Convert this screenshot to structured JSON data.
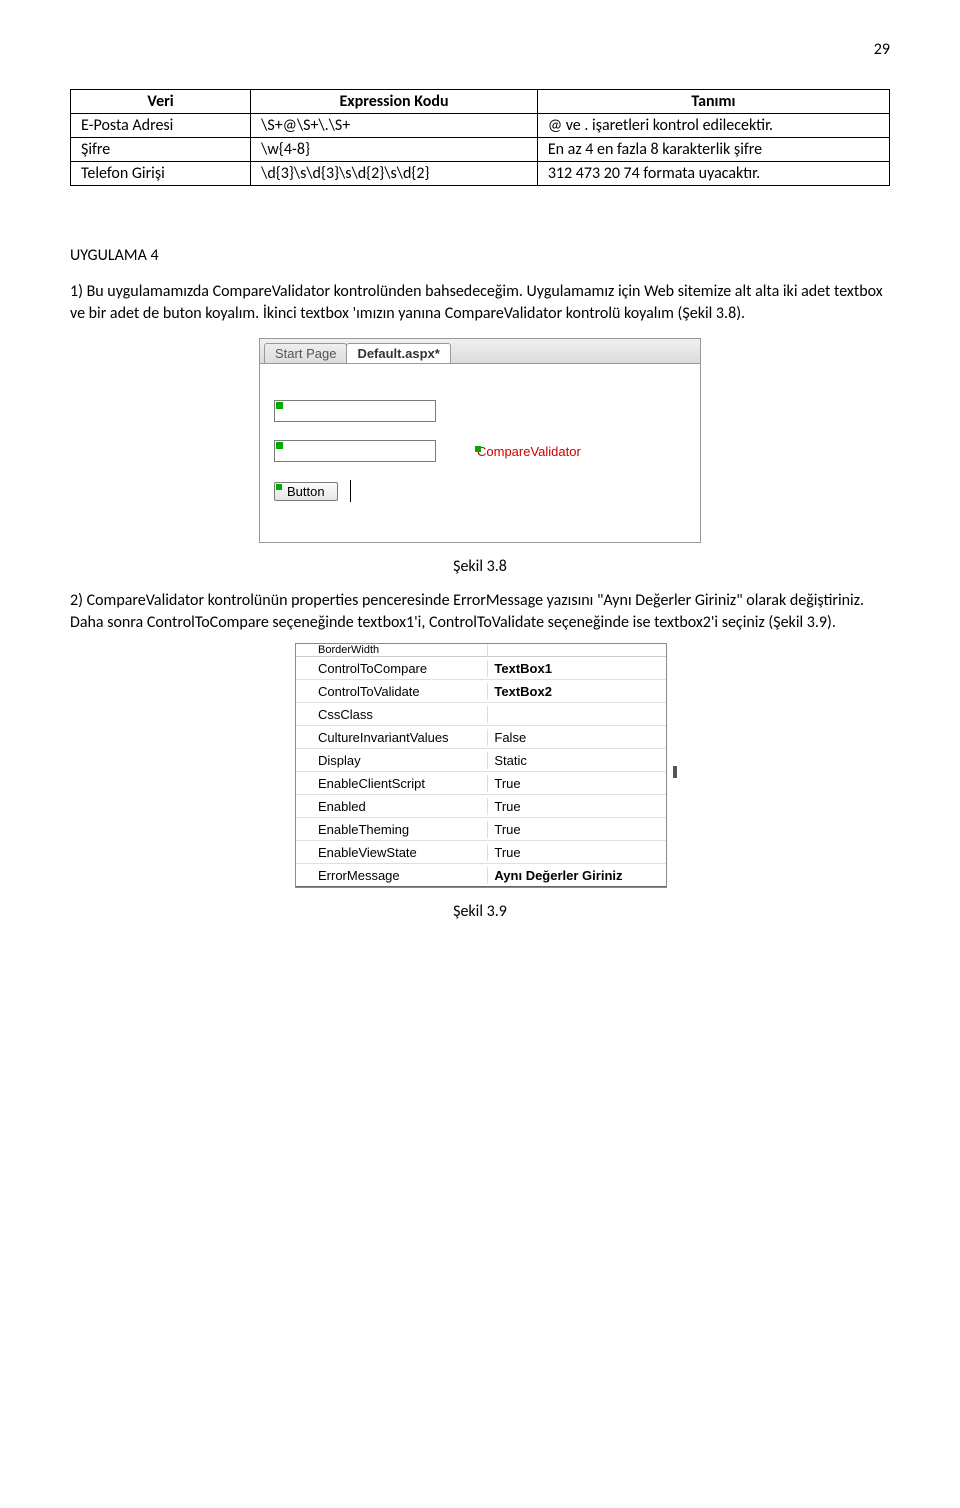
{
  "pageNumber": "29",
  "table": {
    "headers": {
      "col1": "Veri",
      "col2": "Expression Kodu",
      "col3": "Tanımı"
    },
    "rows": [
      {
        "c1": "E-Posta Adresi",
        "c2": "\\S+@\\S+\\.\\S+",
        "c3": "@ ve . işaretleri kontrol edilecektir."
      },
      {
        "c1": "Şifre",
        "c2": "\\w{4-8}",
        "c3": "En az 4 en fazla 8 karakterlik şifre"
      },
      {
        "c1": "Telefon Girişi",
        "c2": "\\d{3}\\s\\d{3}\\s\\d{2}\\s\\d{2}",
        "c3": "312 473 20 74  formata uyacaktır."
      }
    ]
  },
  "uygulamaTitle": "UYGULAMA 4",
  "para1": "1)  Bu uygulamamızda CompareValidator kontrolünden bahsedeceğim. Uygulamamız için Web sitemize alt alta iki adet textbox ve bir adet de buton koyalım. İkinci textbox 'ımızın yanına CompareValidator kontrolü koyalım (Şekil 3.8).",
  "screenshot1": {
    "tabInactive": "Start Page",
    "tabActive": "Default.aspx*",
    "compareValidatorLabel": "CompareValidator",
    "buttonLabel": "Button"
  },
  "caption1": "Şekil 3.8",
  "para2": "2)  CompareValidator kontrolünün properties penceresinde ErrorMessage yazısını \"Aynı Değerler Giriniz\" olarak değiştiriniz. Daha sonra ControlToCompare seçeneğinde textbox1'i, ControlToValidate seçeneğinde ise textbox2'i seçiniz (Şekil 3.9).",
  "properties": {
    "clipTop": "BorderWidth",
    "rows": [
      {
        "name": "ControlToCompare",
        "val": "TextBox1",
        "bold": true
      },
      {
        "name": "ControlToValidate",
        "val": "TextBox2",
        "bold": true
      },
      {
        "name": "CssClass",
        "val": ""
      },
      {
        "name": "CultureInvariantValues",
        "val": "False"
      },
      {
        "name": "Display",
        "val": "Static"
      },
      {
        "name": "EnableClientScript",
        "val": "True"
      },
      {
        "name": "Enabled",
        "val": "True"
      },
      {
        "name": "EnableTheming",
        "val": "True"
      },
      {
        "name": "EnableViewState",
        "val": "True"
      },
      {
        "name": "ErrorMessage",
        "val": "Aynı Değerler Giriniz",
        "bold": true
      }
    ]
  },
  "caption2": "Şekil 3.9"
}
